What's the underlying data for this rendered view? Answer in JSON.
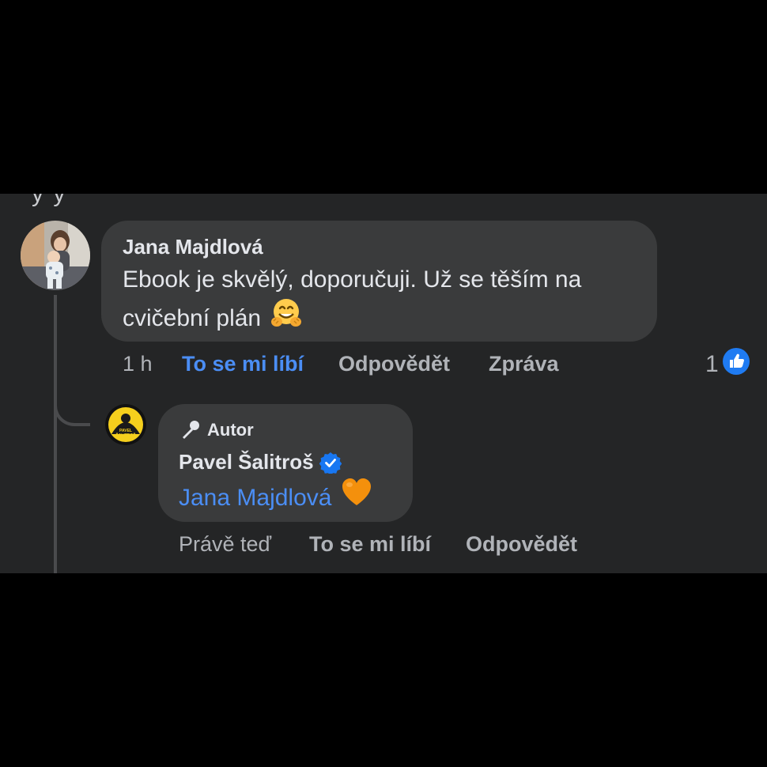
{
  "top_fragment": "y          y",
  "comment": {
    "author": "Jana Majdlová",
    "text_line1": "Ebook je skvělý, doporučuji. Už se těším na",
    "text_line2": "cvičební plán",
    "emoji": "hugging-face",
    "actions": {
      "time": "1 h",
      "like": "To se mi líbí",
      "reply": "Odpovědět",
      "message": "Zpráva"
    },
    "reactions": {
      "count": "1",
      "type": "like"
    }
  },
  "reply": {
    "badge": "Autor",
    "author": "Pavel Šalitroš",
    "verified": true,
    "mention": "Jana Majdlová",
    "emoji": "orange-heart",
    "avatar_text": [
      "PAVEL",
      "ŠALITROŠ"
    ],
    "actions": {
      "time": "Právě teď",
      "like": "To se mi líbí",
      "reply": "Odpovědět"
    }
  },
  "colors": {
    "background": "#242526",
    "bubble": "#3a3b3c",
    "text": "#e4e6eb",
    "secondary_text": "#b0b3b8",
    "link": "#4b8ef5",
    "verified": "#1877f2",
    "avatar_brand": "#f5cf1d"
  }
}
